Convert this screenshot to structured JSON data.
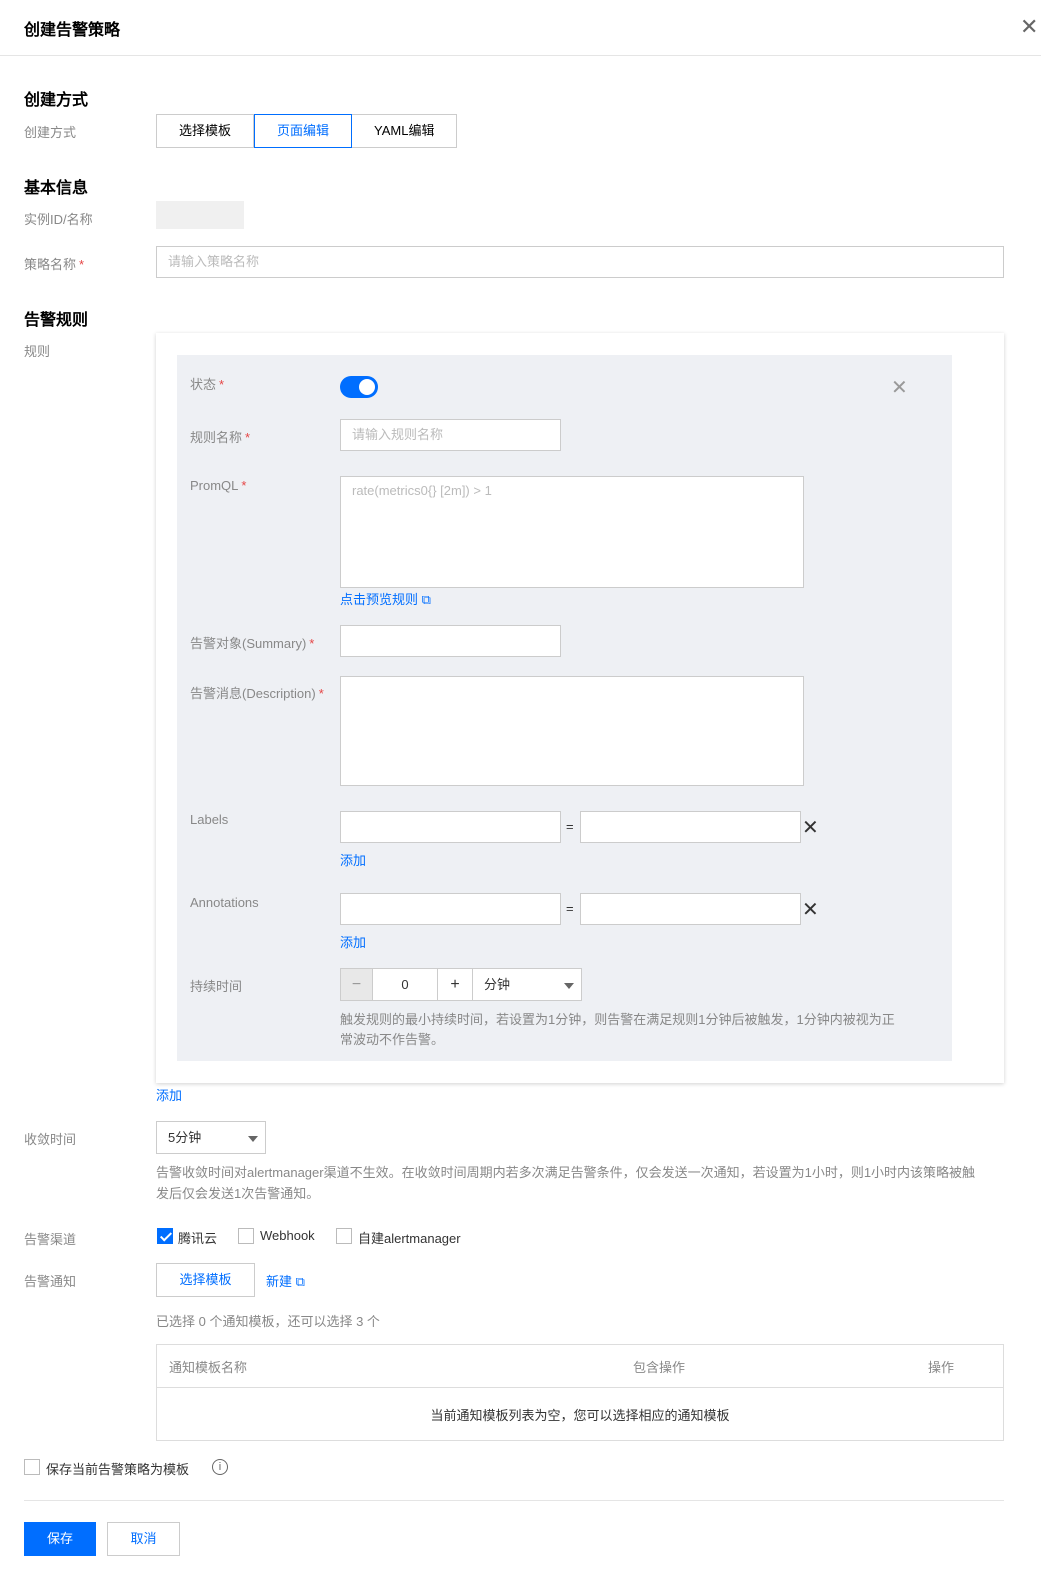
{
  "dialog": {
    "title": "创建告警策略"
  },
  "sections": {
    "create_mode": "创建方式",
    "basic_info": "基本信息",
    "alert_rules": "告警规则"
  },
  "create_mode": {
    "label": "创建方式",
    "options": [
      "选择模板",
      "页面编辑",
      "YAML编辑"
    ],
    "selected": "页面编辑"
  },
  "basic": {
    "instance_label": "实例ID/名称",
    "policy_name_label": "策略名称",
    "policy_name_placeholder": "请输入策略名称"
  },
  "rules": {
    "label": "规则",
    "status_label": "状态",
    "status_on": true,
    "rule_name_label": "规则名称",
    "rule_name_placeholder": "请输入规则名称",
    "promql_label": "PromQL",
    "promql_placeholder": "rate(metrics0{} [2m]) > 1",
    "preview_link": "点击预览规则",
    "summary_label": "告警对象(Summary)",
    "description_label": "告警消息(Description)",
    "labels_label": "Labels",
    "annotations_label": "Annotations",
    "equals": "=",
    "add_link": "添加",
    "duration_label": "持续时间",
    "duration_value": "0",
    "duration_unit": "分钟",
    "duration_hint_1": "触发规则的最小持续时间，若设置为1分钟，则告警在满足规则1分钟后被触发，1分钟内被视为正",
    "duration_hint_2": "常波动不作告警。",
    "add_rule_link": "添加"
  },
  "converge": {
    "label": "收敛时间",
    "value": "5分钟",
    "hint_1": "告警收敛时间对alertmanager渠道不生效。在收敛时间周期内若多次满足告警条件，仅会发送一次通知，若设置为1小时，则1小时内该策略被触",
    "hint_2": "发后仅会发送1次告警通知。"
  },
  "channels": {
    "label": "告警渠道",
    "options": [
      {
        "name": "腾讯云",
        "checked": true
      },
      {
        "name": "Webhook",
        "checked": false
      },
      {
        "name": "自建alertmanager",
        "checked": false
      }
    ]
  },
  "notify": {
    "label": "告警通知",
    "select_template": "选择模板",
    "new_link": "新建",
    "selected_info": "已选择 0 个通知模板，还可以选择 3 个",
    "columns": [
      "通知模板名称",
      "包含操作",
      "操作"
    ],
    "empty": "当前通知模板列表为空，您可以选择相应的通知模板"
  },
  "save_template": {
    "label": "保存当前告警策略为模板",
    "checked": false
  },
  "footer": {
    "save": "保存",
    "cancel": "取消"
  }
}
